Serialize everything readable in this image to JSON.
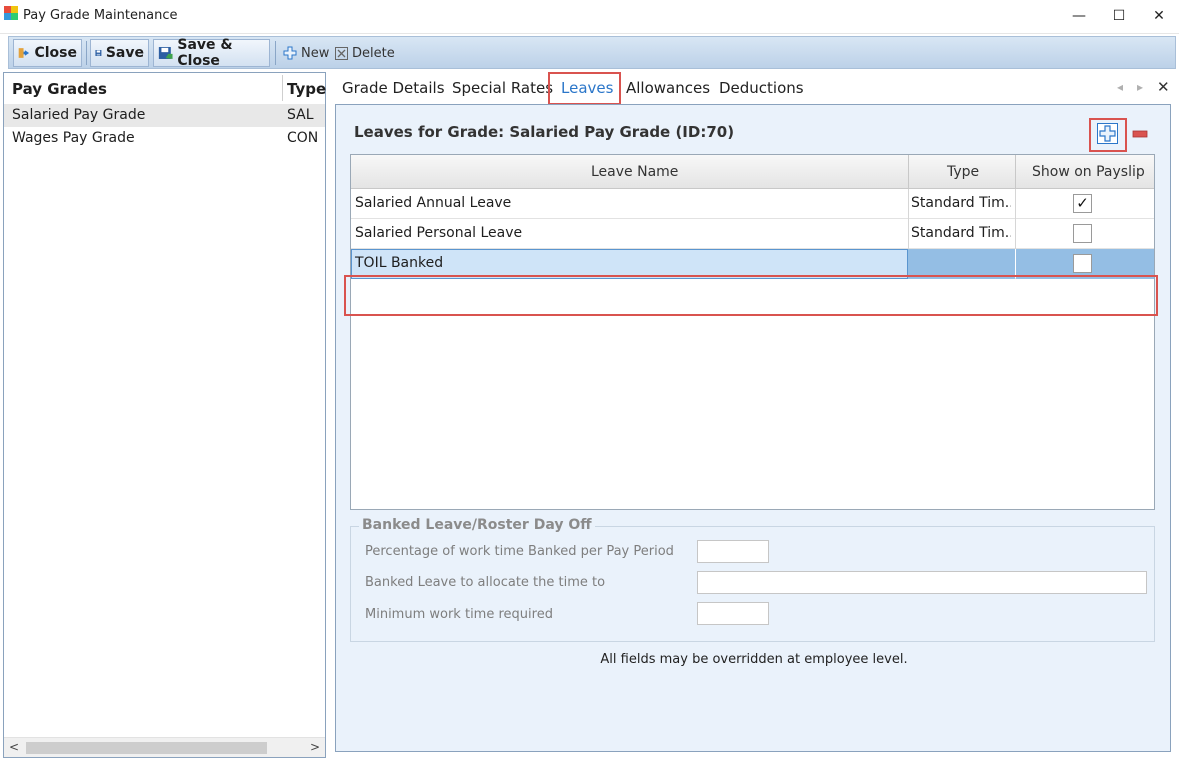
{
  "window": {
    "title": "Pay Grade Maintenance",
    "minimize": "—",
    "maximize": "☐",
    "close": "✕"
  },
  "toolbar": {
    "close_label": "Close",
    "save_label": "Save",
    "save_close_label": "Save & Close",
    "new_label": "New",
    "delete_label": "Delete"
  },
  "pay_grades": {
    "headers": {
      "name": "Pay Grades",
      "type": "Type"
    },
    "rows": [
      {
        "name": "Salaried Pay Grade",
        "type": "SAL",
        "selected": true
      },
      {
        "name": "Wages Pay Grade",
        "type": "CON",
        "selected": false
      }
    ],
    "scroll_left": "<",
    "scroll_right": ">"
  },
  "tabs": {
    "items": [
      "Grade Details",
      "Special Rates",
      "Leaves",
      "Allowances",
      "Deductions"
    ],
    "active": "Leaves",
    "nav_prev": "◂",
    "nav_next": "▸",
    "close": "✕"
  },
  "leaves": {
    "title": "Leaves for Grade: Salaried Pay Grade (ID:70)",
    "columns": {
      "name": "Leave Name",
      "type": "Type",
      "payslip": "Show on Payslip"
    },
    "rows": [
      {
        "name": "Salaried Annual Leave",
        "type": "Standard Tim...",
        "check": "✓"
      },
      {
        "name": "Salaried Personal Leave",
        "type": "Standard Tim...",
        "check": ""
      },
      {
        "name": "TOIL Banked",
        "type": "",
        "check": ""
      }
    ]
  },
  "banked": {
    "group_title": "Banked Leave/Roster Day Off",
    "pct_label": "Percentage of work time Banked per Pay Period",
    "pct_value": "",
    "leave_label": "Banked Leave to allocate the time to",
    "leave_value": "",
    "min_label": "Minimum work time required",
    "min_value": ""
  },
  "footnote": "All fields may be overridden at employee level.",
  "colors": {
    "accent": "#2b76c9",
    "highlight": "#d9534f",
    "selection": "#94bee4"
  }
}
